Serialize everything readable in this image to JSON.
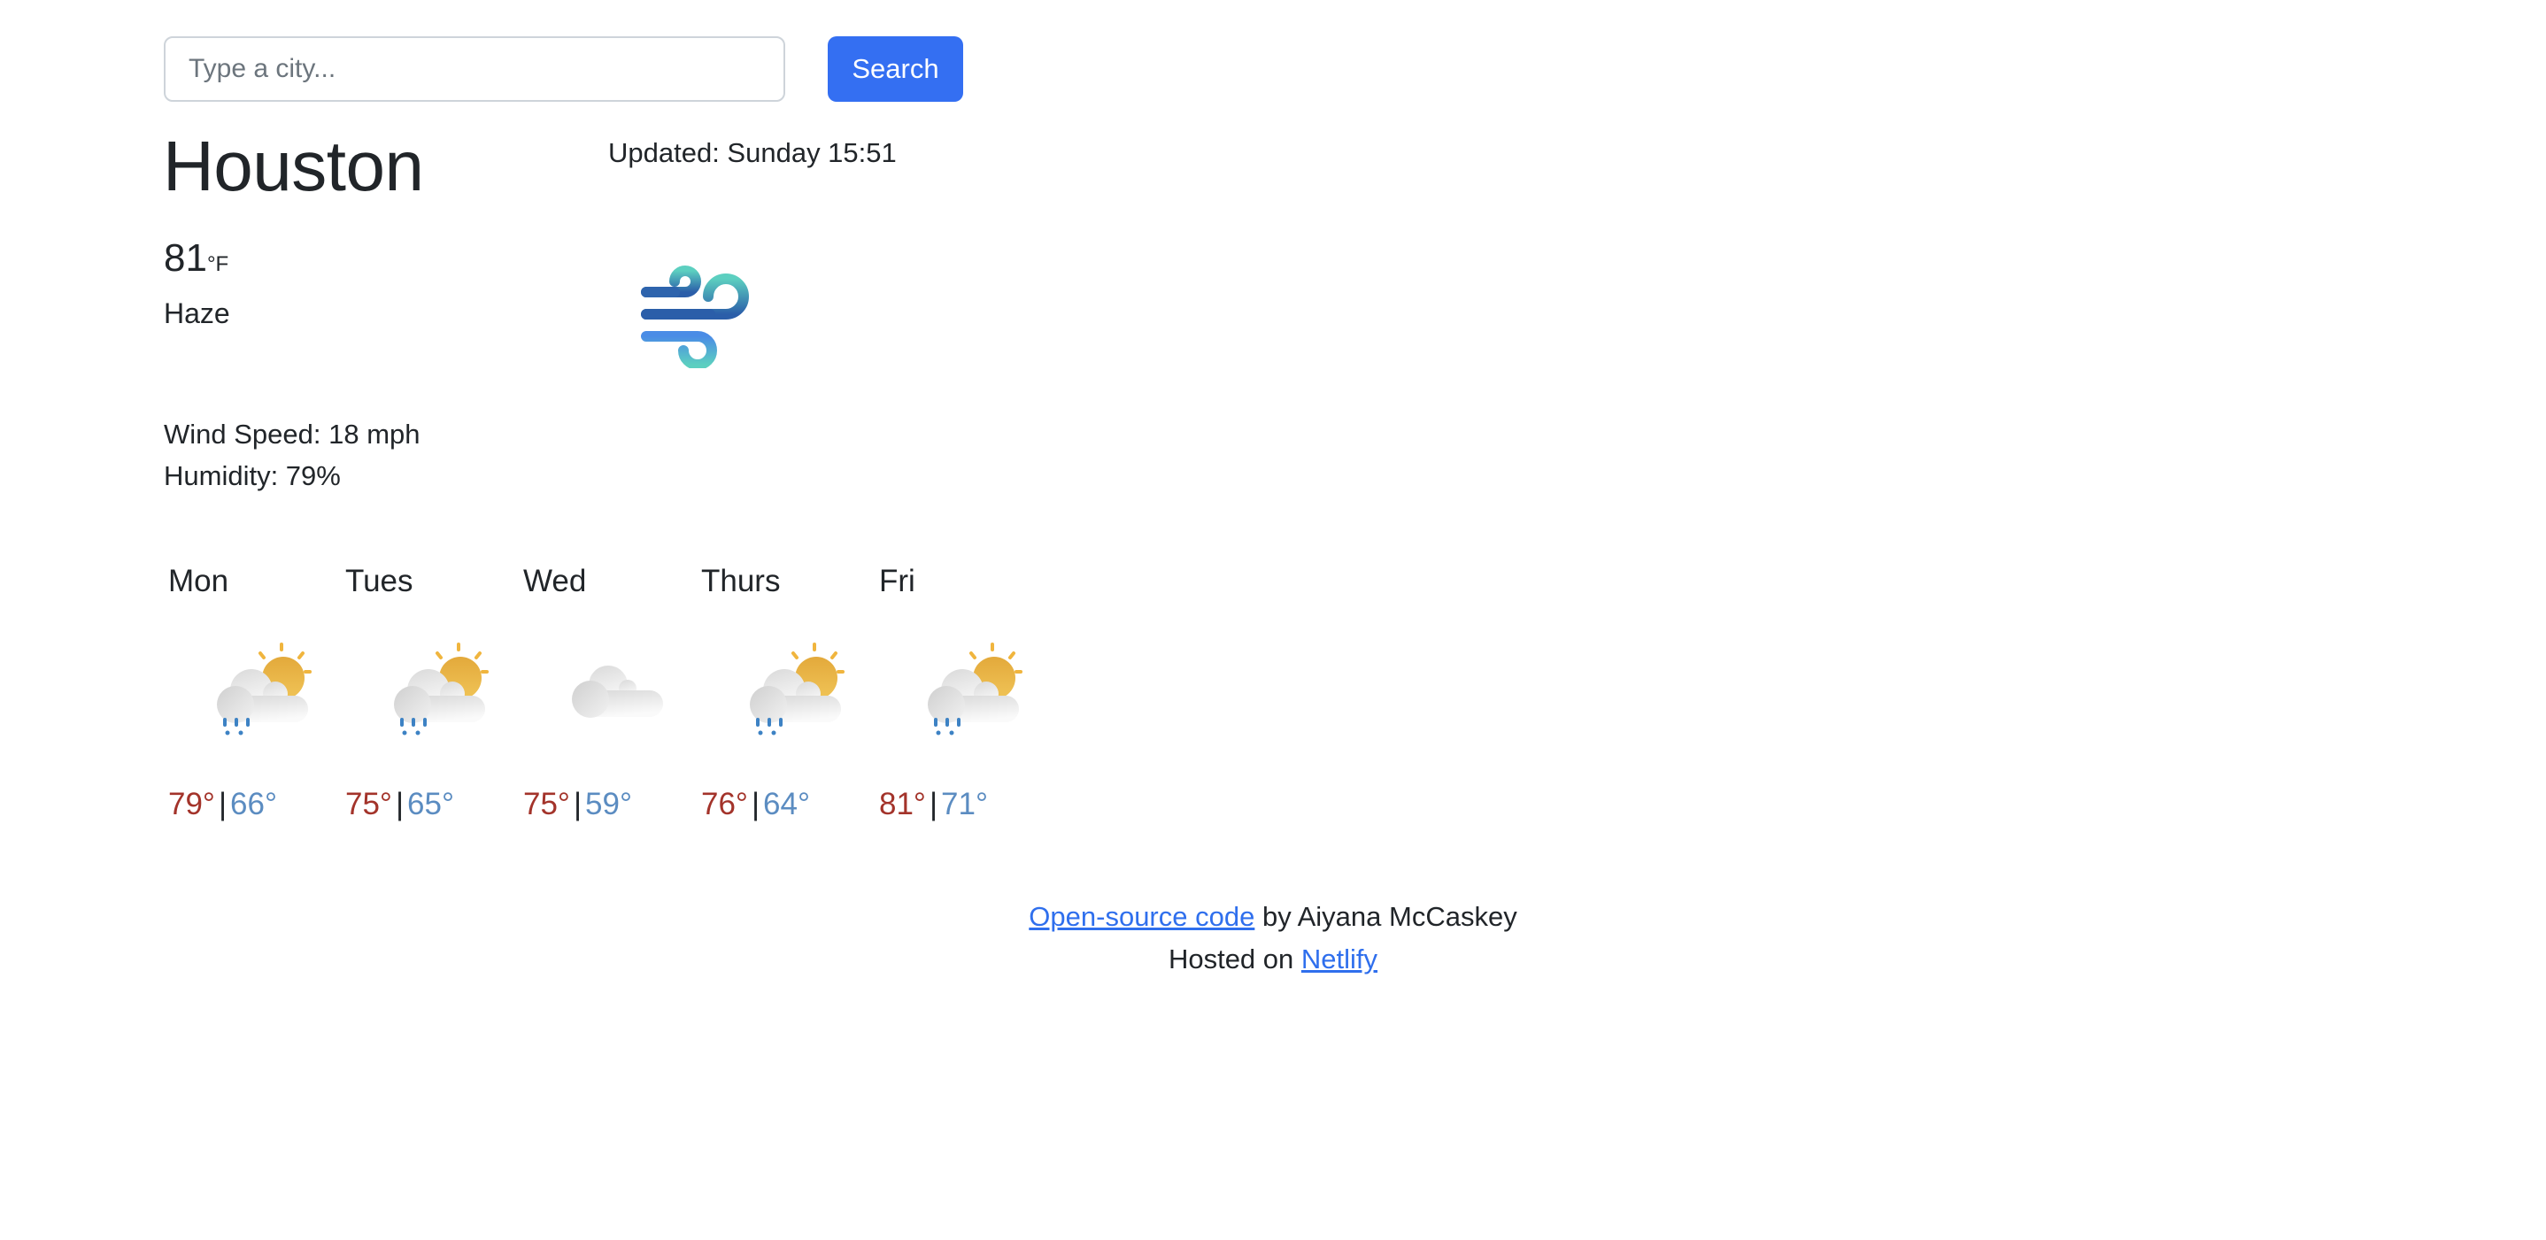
{
  "search": {
    "placeholder": "Type a city...",
    "value": "",
    "button_label": "Search"
  },
  "current": {
    "city": "Houston",
    "updated": "Updated: Sunday 15:51",
    "temperature": "81",
    "unit": "°F",
    "condition": "Haze",
    "icon": "wind-icon",
    "wind_speed": "Wind Speed: 18 mph",
    "humidity": "Humidity: 79%"
  },
  "forecast": [
    {
      "day": "Mon",
      "icon": "partly-cloudy-rain-icon",
      "high": "79°",
      "low": "66°"
    },
    {
      "day": "Tues",
      "icon": "partly-cloudy-rain-icon",
      "high": "75°",
      "low": "65°"
    },
    {
      "day": "Wed",
      "icon": "cloudy-icon",
      "high": "75°",
      "low": "59°"
    },
    {
      "day": "Thurs",
      "icon": "partly-cloudy-rain-icon",
      "high": "76°",
      "low": "64°"
    },
    {
      "day": "Fri",
      "icon": "partly-cloudy-rain-icon",
      "high": "81°",
      "low": "71°"
    }
  ],
  "temp_separator": "|",
  "footer": {
    "code_link": "Open-source code",
    "author_text": " by Aiyana McCaskey",
    "hosted_text": "Hosted on ",
    "host_link": "Netlify"
  },
  "colors": {
    "accent": "#346ff2",
    "high_temp": "#a3332a",
    "low_temp": "#5b8cc1",
    "link": "#2f6fed",
    "text": "#212529"
  }
}
